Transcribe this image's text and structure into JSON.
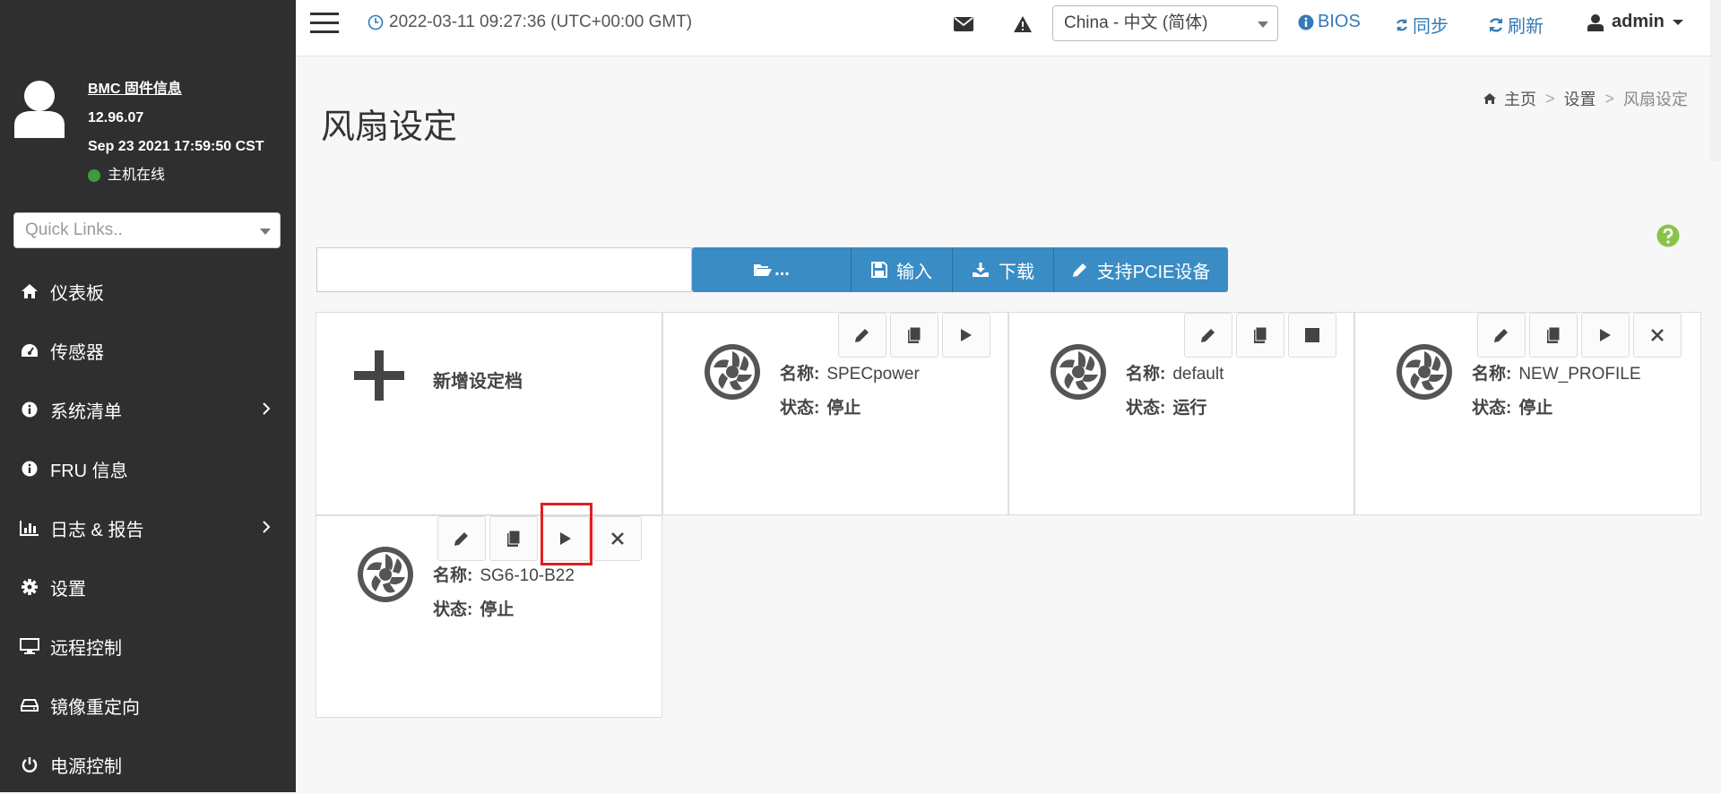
{
  "sidebar": {
    "firmware_title": "BMC 固件信息",
    "firmware_version": "12.96.07",
    "firmware_date": "Sep 23 2021 17:59:50 CST",
    "host_status": "主机在线",
    "quick_links_placeholder": "Quick Links..",
    "items": [
      {
        "label": "仪表板",
        "icon": "home-icon"
      },
      {
        "label": "传感器",
        "icon": "gauge-icon"
      },
      {
        "label": "系统清单",
        "icon": "info-icon",
        "has_submenu": true
      },
      {
        "label": "FRU 信息",
        "icon": "info-icon"
      },
      {
        "label": "日志 & 报告",
        "icon": "bar-chart-icon",
        "has_submenu": true
      },
      {
        "label": "设置",
        "icon": "gear-icon"
      },
      {
        "label": "远程控制",
        "icon": "monitor-icon"
      },
      {
        "label": "镜像重定向",
        "icon": "drive-icon"
      },
      {
        "label": "电源控制",
        "icon": "power-icon"
      }
    ]
  },
  "topbar": {
    "datetime": "2022-03-11 09:27:36 (UTC+00:00 GMT)",
    "language": "China - 中文 (简体)",
    "bios_label": "BIOS",
    "sync_label": "同步",
    "refresh_label": "刷新",
    "user": "admin"
  },
  "page": {
    "title": "风扇设定",
    "breadcrumb": [
      "主页",
      "设置",
      "风扇设定"
    ]
  },
  "toolbar": {
    "browse_label": "...",
    "import_label": "输入",
    "download_label": "下载",
    "pcie_label": "支持PCIE设备"
  },
  "add_profile_label": "新增设定档",
  "labels": {
    "name": "名称:",
    "status": "状态:"
  },
  "profiles": [
    {
      "name": "SPECpower",
      "status": "停止",
      "actions": [
        "edit",
        "copy",
        "play"
      ]
    },
    {
      "name": "default",
      "status": "运行",
      "actions": [
        "edit",
        "copy",
        "stop"
      ]
    },
    {
      "name": "NEW_PROFILE",
      "status": "停止",
      "actions": [
        "edit",
        "copy",
        "play",
        "delete"
      ]
    },
    {
      "name": "SG6-10-B22",
      "status": "停止",
      "actions": [
        "edit",
        "copy",
        "play",
        "delete"
      ]
    }
  ],
  "colors": {
    "sidebar_bg": "#2f2f2f",
    "accent": "#3a8cc5",
    "online": "#3e9b3e",
    "highlight": "#e02020",
    "help": "#8bc34a"
  }
}
